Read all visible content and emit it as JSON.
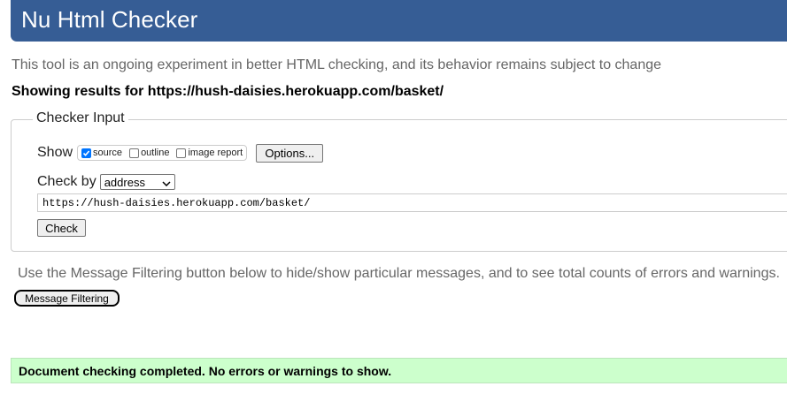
{
  "header": {
    "title": "Nu Html Checker"
  },
  "intro": {
    "text": "This tool is an ongoing experiment in better HTML checking, and its behavior remains subject to change"
  },
  "results": {
    "showing_for": "Showing results for https://hush-daisies.herokuapp.com/basket/"
  },
  "checker_input": {
    "legend": "Checker Input",
    "show_label": "Show",
    "options": [
      {
        "label": "source",
        "checked": true
      },
      {
        "label": "outline",
        "checked": false
      },
      {
        "label": "image report",
        "checked": false
      }
    ],
    "options_button": "Options...",
    "check_by_label": "Check by",
    "check_by_selected": "address",
    "url_value": "https://hush-daisies.herokuapp.com/basket/",
    "check_button": "Check"
  },
  "filtering": {
    "note": "Use the Message Filtering button below to hide/show particular messages, and to see total counts of errors and warnings.",
    "button": "Message Filtering"
  },
  "status": {
    "message": "Document checking completed. No errors or warnings to show.",
    "color": "#ccffcc"
  },
  "colors": {
    "header_bg": "#365d95",
    "checkbox_checked": "#0075ff"
  }
}
